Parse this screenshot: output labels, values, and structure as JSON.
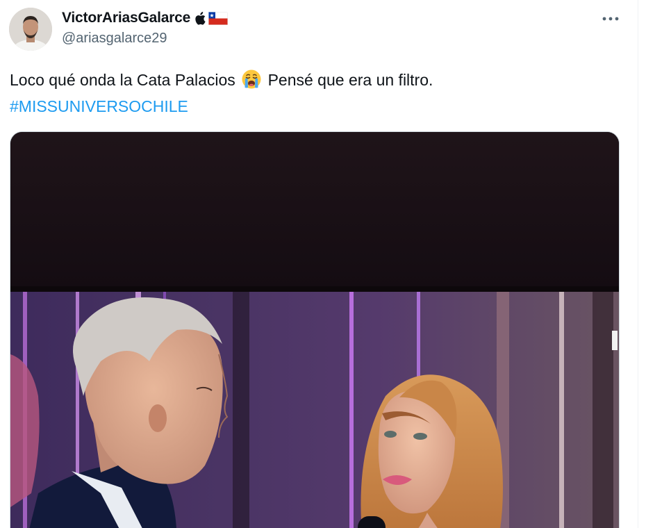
{
  "tweet": {
    "author": {
      "display_name": "VictorAriasGalarce",
      "badges": [
        "apple-icon",
        "chile-flag-icon"
      ],
      "handle": "@ariasgalarce29"
    },
    "more_label": "More",
    "text_parts": {
      "part1": "Loco qué onda la Cata Palacios ",
      "emoji": "loudly-crying-face-icon",
      "part2": " Pensé que era un filtro.",
      "hashtag": "#MISSUNIVERSOCHILE"
    },
    "media": {
      "kind": "photo",
      "alt": "Image"
    }
  },
  "colors": {
    "text": "#0f1419",
    "secondary": "#536471",
    "link": "#1d9bf0",
    "border": "#cfd9de"
  }
}
